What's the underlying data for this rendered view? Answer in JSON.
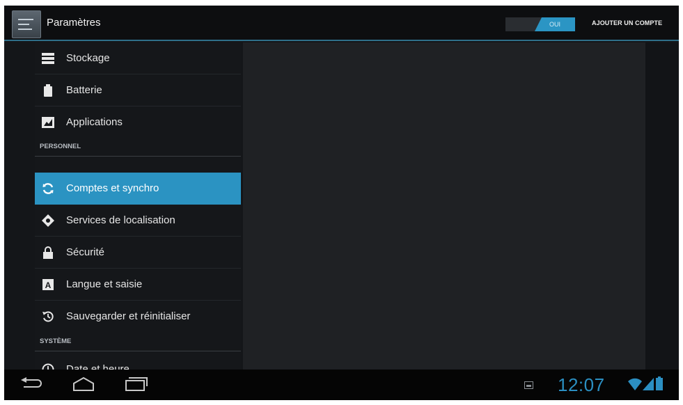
{
  "actionbar": {
    "title": "Paramètres",
    "toggle_label": "OUI",
    "add_account": "AJOUTER UN COMPTE"
  },
  "sidebar": {
    "items_top": [
      {
        "label": "Stockage",
        "icon": "storage-icon"
      },
      {
        "label": "Batterie",
        "icon": "battery-icon"
      },
      {
        "label": "Applications",
        "icon": "apps-icon"
      }
    ],
    "header_personal": "PERSONNEL",
    "items_personal": [
      {
        "label": "Comptes et synchro",
        "icon": "sync-icon",
        "selected": true
      },
      {
        "label": "Services de localisation",
        "icon": "location-icon"
      },
      {
        "label": "Sécurité",
        "icon": "lock-icon"
      },
      {
        "label": "Langue et saisie",
        "icon": "language-icon"
      },
      {
        "label": "Sauvegarder et réinitialiser",
        "icon": "backup-icon"
      }
    ],
    "header_system": "SYSTÈME",
    "items_system": [
      {
        "label": "Date et heure",
        "icon": "clock-icon"
      }
    ]
  },
  "statusbar": {
    "time": "12:07"
  },
  "colors": {
    "accent": "#2b93c2",
    "background": "#141619",
    "navbar": "#050505"
  }
}
